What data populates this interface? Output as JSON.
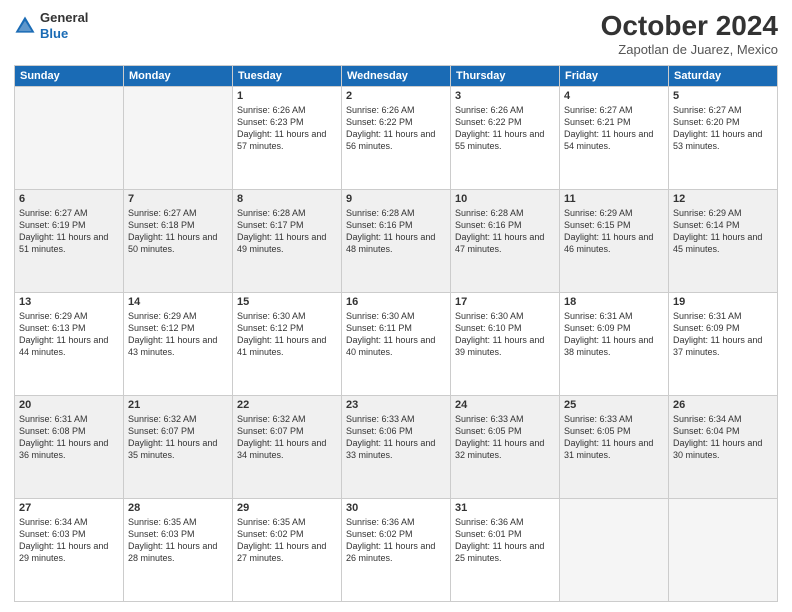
{
  "header": {
    "logo_general": "General",
    "logo_blue": "Blue",
    "month_title": "October 2024",
    "location": "Zapotlan de Juarez, Mexico"
  },
  "days_of_week": [
    "Sunday",
    "Monday",
    "Tuesday",
    "Wednesday",
    "Thursday",
    "Friday",
    "Saturday"
  ],
  "weeks": [
    [
      {
        "day": "",
        "info": ""
      },
      {
        "day": "",
        "info": ""
      },
      {
        "day": "1",
        "info": "Sunrise: 6:26 AM\nSunset: 6:23 PM\nDaylight: 11 hours and 57 minutes."
      },
      {
        "day": "2",
        "info": "Sunrise: 6:26 AM\nSunset: 6:22 PM\nDaylight: 11 hours and 56 minutes."
      },
      {
        "day": "3",
        "info": "Sunrise: 6:26 AM\nSunset: 6:22 PM\nDaylight: 11 hours and 55 minutes."
      },
      {
        "day": "4",
        "info": "Sunrise: 6:27 AM\nSunset: 6:21 PM\nDaylight: 11 hours and 54 minutes."
      },
      {
        "day": "5",
        "info": "Sunrise: 6:27 AM\nSunset: 6:20 PM\nDaylight: 11 hours and 53 minutes."
      }
    ],
    [
      {
        "day": "6",
        "info": "Sunrise: 6:27 AM\nSunset: 6:19 PM\nDaylight: 11 hours and 51 minutes."
      },
      {
        "day": "7",
        "info": "Sunrise: 6:27 AM\nSunset: 6:18 PM\nDaylight: 11 hours and 50 minutes."
      },
      {
        "day": "8",
        "info": "Sunrise: 6:28 AM\nSunset: 6:17 PM\nDaylight: 11 hours and 49 minutes."
      },
      {
        "day": "9",
        "info": "Sunrise: 6:28 AM\nSunset: 6:16 PM\nDaylight: 11 hours and 48 minutes."
      },
      {
        "day": "10",
        "info": "Sunrise: 6:28 AM\nSunset: 6:16 PM\nDaylight: 11 hours and 47 minutes."
      },
      {
        "day": "11",
        "info": "Sunrise: 6:29 AM\nSunset: 6:15 PM\nDaylight: 11 hours and 46 minutes."
      },
      {
        "day": "12",
        "info": "Sunrise: 6:29 AM\nSunset: 6:14 PM\nDaylight: 11 hours and 45 minutes."
      }
    ],
    [
      {
        "day": "13",
        "info": "Sunrise: 6:29 AM\nSunset: 6:13 PM\nDaylight: 11 hours and 44 minutes."
      },
      {
        "day": "14",
        "info": "Sunrise: 6:29 AM\nSunset: 6:12 PM\nDaylight: 11 hours and 43 minutes."
      },
      {
        "day": "15",
        "info": "Sunrise: 6:30 AM\nSunset: 6:12 PM\nDaylight: 11 hours and 41 minutes."
      },
      {
        "day": "16",
        "info": "Sunrise: 6:30 AM\nSunset: 6:11 PM\nDaylight: 11 hours and 40 minutes."
      },
      {
        "day": "17",
        "info": "Sunrise: 6:30 AM\nSunset: 6:10 PM\nDaylight: 11 hours and 39 minutes."
      },
      {
        "day": "18",
        "info": "Sunrise: 6:31 AM\nSunset: 6:09 PM\nDaylight: 11 hours and 38 minutes."
      },
      {
        "day": "19",
        "info": "Sunrise: 6:31 AM\nSunset: 6:09 PM\nDaylight: 11 hours and 37 minutes."
      }
    ],
    [
      {
        "day": "20",
        "info": "Sunrise: 6:31 AM\nSunset: 6:08 PM\nDaylight: 11 hours and 36 minutes."
      },
      {
        "day": "21",
        "info": "Sunrise: 6:32 AM\nSunset: 6:07 PM\nDaylight: 11 hours and 35 minutes."
      },
      {
        "day": "22",
        "info": "Sunrise: 6:32 AM\nSunset: 6:07 PM\nDaylight: 11 hours and 34 minutes."
      },
      {
        "day": "23",
        "info": "Sunrise: 6:33 AM\nSunset: 6:06 PM\nDaylight: 11 hours and 33 minutes."
      },
      {
        "day": "24",
        "info": "Sunrise: 6:33 AM\nSunset: 6:05 PM\nDaylight: 11 hours and 32 minutes."
      },
      {
        "day": "25",
        "info": "Sunrise: 6:33 AM\nSunset: 6:05 PM\nDaylight: 11 hours and 31 minutes."
      },
      {
        "day": "26",
        "info": "Sunrise: 6:34 AM\nSunset: 6:04 PM\nDaylight: 11 hours and 30 minutes."
      }
    ],
    [
      {
        "day": "27",
        "info": "Sunrise: 6:34 AM\nSunset: 6:03 PM\nDaylight: 11 hours and 29 minutes."
      },
      {
        "day": "28",
        "info": "Sunrise: 6:35 AM\nSunset: 6:03 PM\nDaylight: 11 hours and 28 minutes."
      },
      {
        "day": "29",
        "info": "Sunrise: 6:35 AM\nSunset: 6:02 PM\nDaylight: 11 hours and 27 minutes."
      },
      {
        "day": "30",
        "info": "Sunrise: 6:36 AM\nSunset: 6:02 PM\nDaylight: 11 hours and 26 minutes."
      },
      {
        "day": "31",
        "info": "Sunrise: 6:36 AM\nSunset: 6:01 PM\nDaylight: 11 hours and 25 minutes."
      },
      {
        "day": "",
        "info": ""
      },
      {
        "day": "",
        "info": ""
      }
    ]
  ]
}
